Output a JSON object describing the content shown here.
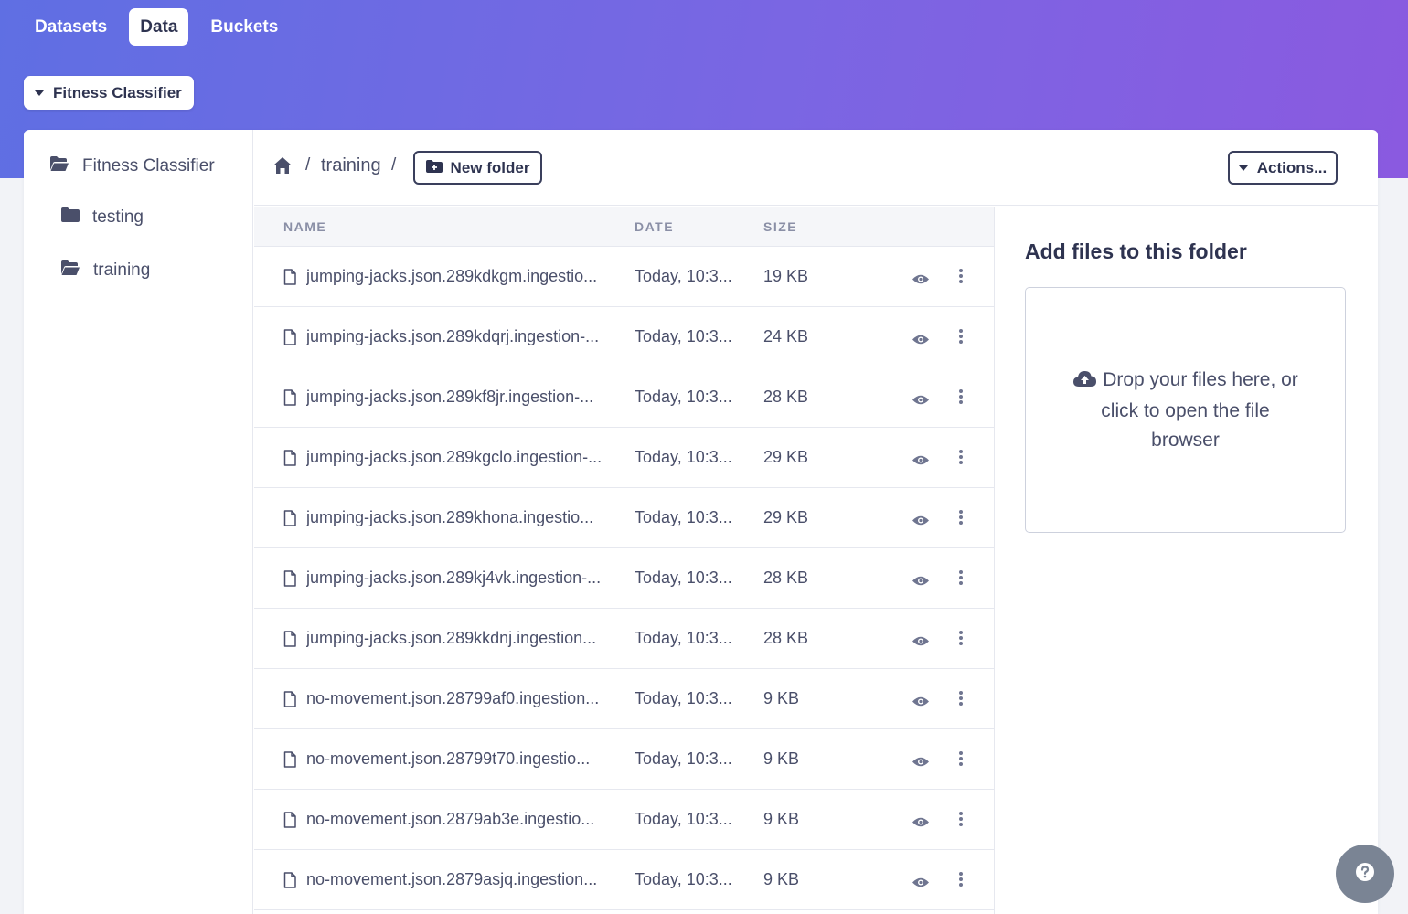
{
  "top_tabs": [
    {
      "label": "Datasets",
      "active": false
    },
    {
      "label": "Data",
      "active": true
    },
    {
      "label": "Buckets",
      "active": false
    }
  ],
  "project": {
    "label": "Fitness Classifier"
  },
  "sidebar": {
    "root": {
      "label": "Fitness Classifier",
      "icon": "folder-open-icon"
    },
    "items": [
      {
        "label": "testing",
        "icon": "folder-icon"
      },
      {
        "label": "training",
        "icon": "folder-open-icon"
      }
    ]
  },
  "toolbar": {
    "breadcrumb_sep": "/",
    "crumb": "training",
    "new_folder_label": "New folder",
    "actions_label": "Actions..."
  },
  "table": {
    "columns": {
      "name": "NAME",
      "date": "DATE",
      "size": "SIZE"
    },
    "rows": [
      {
        "name": "jumping-jacks.json.289kdkgm.ingestio...",
        "date": "Today, 10:3...",
        "size": "19 KB"
      },
      {
        "name": "jumping-jacks.json.289kdqrj.ingestion-...",
        "date": "Today, 10:3...",
        "size": "24 KB"
      },
      {
        "name": "jumping-jacks.json.289kf8jr.ingestion-...",
        "date": "Today, 10:3...",
        "size": "28 KB"
      },
      {
        "name": "jumping-jacks.json.289kgclo.ingestion-...",
        "date": "Today, 10:3...",
        "size": "29 KB"
      },
      {
        "name": "jumping-jacks.json.289khona.ingestio...",
        "date": "Today, 10:3...",
        "size": "29 KB"
      },
      {
        "name": "jumping-jacks.json.289kj4vk.ingestion-...",
        "date": "Today, 10:3...",
        "size": "28 KB"
      },
      {
        "name": "jumping-jacks.json.289kkdnj.ingestion...",
        "date": "Today, 10:3...",
        "size": "28 KB"
      },
      {
        "name": "no-movement.json.28799af0.ingestion...",
        "date": "Today, 10:3...",
        "size": "9 KB"
      },
      {
        "name": "no-movement.json.28799t70.ingestio...",
        "date": "Today, 10:3...",
        "size": "9 KB"
      },
      {
        "name": "no-movement.json.2879ab3e.ingestio...",
        "date": "Today, 10:3...",
        "size": "9 KB"
      },
      {
        "name": "no-movement.json.2879asjq.ingestion...",
        "date": "Today, 10:3...",
        "size": "9 KB"
      }
    ]
  },
  "upload": {
    "title": "Add files to this folder",
    "drop_text": "Drop your files here, or click to open the file browser",
    "icon": "cloud-upload-icon"
  },
  "help": {
    "icon": "question-icon"
  },
  "colors": {
    "gradient_start": "#5f6fe3",
    "gradient_end": "#8a5ae0",
    "text_dark": "#2e3350",
    "icon_gray": "#7a8494"
  }
}
